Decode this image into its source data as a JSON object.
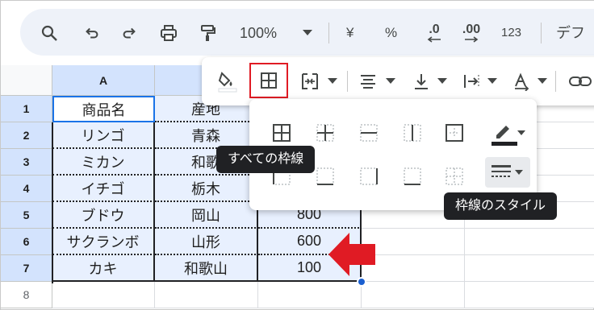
{
  "toolbar": {
    "zoom": "100%",
    "currency": "¥",
    "percent": "%",
    "decrease_decimal": ".0",
    "increase_decimal": ".00",
    "number_format": "123",
    "font_name": "デフ"
  },
  "columns": [
    "A"
  ],
  "rows": [
    {
      "num": "1",
      "a": "商品名",
      "b": "産地",
      "c": ""
    },
    {
      "num": "2",
      "a": "リンゴ",
      "b": "青森",
      "c": ""
    },
    {
      "num": "3",
      "a": "ミカン",
      "b": "和歌",
      "c": ""
    },
    {
      "num": "4",
      "a": "イチゴ",
      "b": "栃木",
      "c": ""
    },
    {
      "num": "5",
      "a": "ブドウ",
      "b": "岡山",
      "c": "800"
    },
    {
      "num": "6",
      "a": "サクランボ",
      "b": "山形",
      "c": "600"
    },
    {
      "num": "7",
      "a": "カキ",
      "b": "和歌山",
      "c": "100"
    },
    {
      "num": "8",
      "a": "",
      "b": "",
      "c": ""
    }
  ],
  "tooltips": {
    "all_borders": "すべての枠線",
    "border_style": "枠線のスタイル"
  },
  "colors": {
    "highlight_red": "#e01b24",
    "header_blue": "#d3e3fd",
    "selection_fill": "#e8f0fe"
  }
}
